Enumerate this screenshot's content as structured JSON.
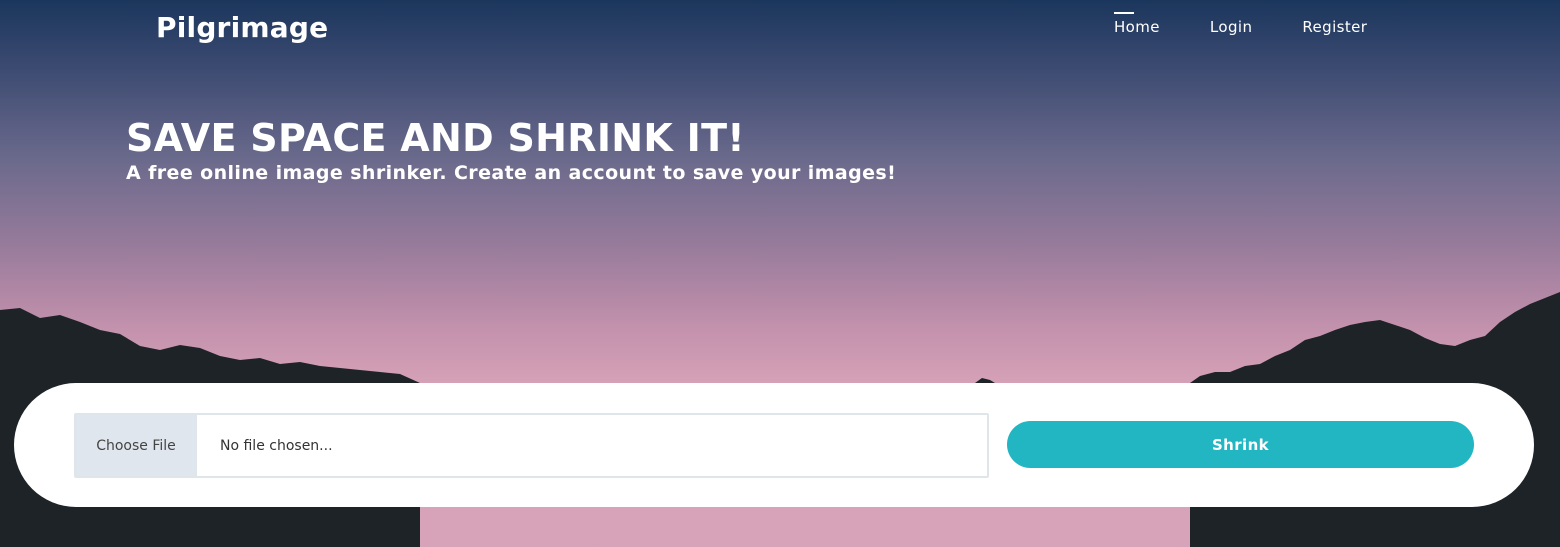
{
  "header": {
    "brand": "Pilgrimage",
    "nav": [
      {
        "label": "Home",
        "active": true
      },
      {
        "label": "Login",
        "active": false
      },
      {
        "label": "Register",
        "active": false
      }
    ]
  },
  "hero": {
    "title": "SAVE SPACE AND SHRINK IT!",
    "subtitle": "A free online image shrinker. Create an account to save your images!"
  },
  "upload": {
    "choose_label": "Choose File",
    "file_status": "No file chosen...",
    "submit_label": "Shrink"
  },
  "colors": {
    "accent": "#22b5c2",
    "sky_top": "#1b365c",
    "sky_bottom": "#d7a3b8",
    "mountain": "#1d2327"
  }
}
